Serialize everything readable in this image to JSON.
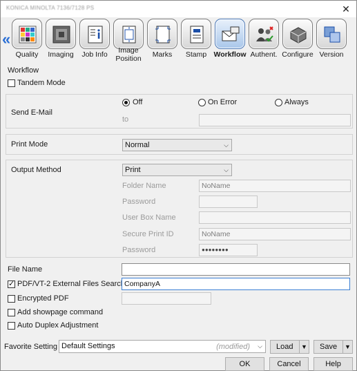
{
  "window": {
    "title": "KONICA MINOLTA 7136/7128 PS",
    "close_glyph": "✕"
  },
  "tabs": {
    "scroll_glyph": "«",
    "items": [
      {
        "label": "Quality",
        "icon": "quality-icon"
      },
      {
        "label": "Imaging",
        "icon": "imaging-icon"
      },
      {
        "label": "Job Info",
        "icon": "job-info-icon"
      },
      {
        "label": "Image Position",
        "line1": "Image",
        "line2": "Position",
        "icon": "image-position-icon"
      },
      {
        "label": "Marks",
        "icon": "marks-icon"
      },
      {
        "label": "Stamp",
        "icon": "stamp-icon"
      },
      {
        "label": "Workflow",
        "icon": "workflow-icon",
        "active": true
      },
      {
        "label": "Authent.",
        "icon": "authentication-icon"
      },
      {
        "label": "Configure",
        "icon": "configure-icon"
      },
      {
        "label": "Version",
        "icon": "version-icon"
      }
    ]
  },
  "workflow": {
    "section_label": "Workflow",
    "tandem_mode": {
      "label": "Tandem Mode",
      "checked": false
    },
    "send_email": {
      "label": "Send E-Mail",
      "options": [
        {
          "label": "Off",
          "selected": true
        },
        {
          "label": "On Error",
          "selected": false
        },
        {
          "label": "Always",
          "selected": false
        }
      ],
      "to_label": "to",
      "to_value": ""
    },
    "print_mode": {
      "label": "Print Mode",
      "value": "Normal"
    },
    "output_method": {
      "label": "Output Method",
      "value": "Print",
      "folder_name_label": "Folder Name",
      "folder_name_value": "NoName",
      "password_label": "Password",
      "password_value": "",
      "user_box_label": "User Box Name",
      "user_box_value": "",
      "secure_id_label": "Secure Print ID",
      "secure_id_value": "NoName",
      "secure_password_label": "Password",
      "secure_password_value": "●●●●●●●●"
    },
    "file_name": {
      "label": "File Name",
      "value": ""
    },
    "pdf_vt2": {
      "label": "PDF/VT-2 External Files Search",
      "checked": true,
      "value": "CompanyA"
    },
    "encrypted_pdf": {
      "label": "Encrypted PDF",
      "checked": false,
      "value": ""
    },
    "add_showpage": {
      "label": "Add showpage command",
      "checked": false
    },
    "auto_duplex": {
      "label": "Auto Duplex Adjustment",
      "checked": false
    }
  },
  "favorite": {
    "label": "Favorite Setting",
    "value": "Default Settings",
    "modified": "(modified)",
    "load_label": "Load",
    "save_label": "Save"
  },
  "buttons": {
    "ok": "OK",
    "cancel": "Cancel",
    "help": "Help"
  },
  "colors": {
    "accent": "#2a6fd6",
    "focus_border": "#3b7fd4",
    "active_tab": "#a9c7ea"
  }
}
